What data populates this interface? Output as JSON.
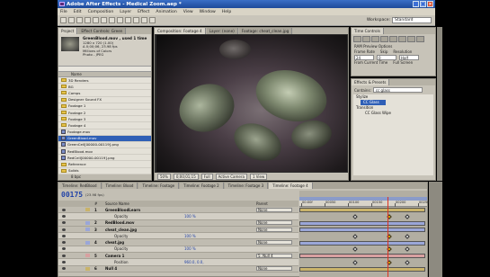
{
  "window": {
    "title": "Adobe After Effects - Medical Zoom.aep *"
  },
  "menu": [
    "File",
    "Edit",
    "Composition",
    "Layer",
    "Effect",
    "Animation",
    "View",
    "Window",
    "Help"
  ],
  "toolbar": {
    "workspace_label": "Workspace:",
    "workspace_value": "Standard"
  },
  "project": {
    "tabs": [
      "Project",
      "Effect Controls: Green"
    ],
    "selected_name": "GreenBlood.mov , used 1 time",
    "meta": [
      "1280 x 720 (1.00)",
      "Δ 0;00;06, 23.98 fps",
      "Millions of Colors",
      "Photo - JPEG"
    ],
    "column_header": "Name",
    "items": [
      {
        "label": "3D Renders",
        "kind": "folder"
      },
      {
        "label": "BG",
        "kind": "folder"
      },
      {
        "label": "Comps",
        "kind": "folder"
      },
      {
        "label": "Designer Sound FX",
        "kind": "folder"
      },
      {
        "label": "Footage 1",
        "kind": "folder"
      },
      {
        "label": "Footage 2",
        "kind": "folder"
      },
      {
        "label": "Footage 3",
        "kind": "folder"
      },
      {
        "label": "Footage 4",
        "kind": "folder"
      },
      {
        "label": "Footage.mov",
        "kind": "file"
      },
      {
        "label": "GreenBlood.mov",
        "kind": "file",
        "selected": true
      },
      {
        "label": "GreenCell[00000-00119].png",
        "kind": "file"
      },
      {
        "label": "RedBlood.mov",
        "kind": "file"
      },
      {
        "label": "RedCell[00000-00119].png",
        "kind": "file"
      },
      {
        "label": "Reference",
        "kind": "folder"
      },
      {
        "label": "Solids",
        "kind": "folder"
      }
    ],
    "footer": "8 bpc"
  },
  "composition": {
    "tabs": [
      "Composition: Footage 4",
      "Layer: (none)",
      "Footage: cheat_clean.jpg"
    ],
    "zoom": "50%",
    "timecode": "0;00;01;15",
    "resolution": "Full",
    "camera": "Active Camera",
    "views": "1 View"
  },
  "time_controls": {
    "tab": "Time Controls",
    "subtab": "RAM Preview Options",
    "labels": [
      "Frame Rate",
      "Skip",
      "Resolution"
    ],
    "values": [
      "24",
      "0",
      "Half"
    ],
    "options": [
      "From Current Time",
      "Full Screen"
    ]
  },
  "effects": {
    "tab": "Effects & Presets",
    "contains_label": "Contains:",
    "search_value": "cc glass",
    "items": [
      {
        "label": "Stylize",
        "indent": 0
      },
      {
        "label": "CC Glass",
        "indent": 1,
        "selected": true
      },
      {
        "label": "Transition",
        "indent": 0
      },
      {
        "label": "CC Glass Wipe",
        "indent": 1
      }
    ]
  },
  "timeline": {
    "tabs": [
      "Timeline: RedBlood",
      "Timeline: Blood",
      "Timeline: Footage",
      "Timeline: Footage 2",
      "Timeline: Footage 3",
      "Timeline: Footage 4"
    ],
    "current_time": "00175",
    "fps": "(23.98 fps)",
    "headers": [
      "#",
      "Source Name",
      "Parent"
    ],
    "ruler_labels": [
      "00:00f",
      "00050",
      "00100",
      "00150",
      "00200",
      "00250"
    ],
    "rows": [
      {
        "num": "1",
        "name": "GreenBloodLearn",
        "parent": "None",
        "kind": "layer"
      },
      {
        "num": "",
        "name": "Opacity",
        "value": "100 %",
        "kind": "prop"
      },
      {
        "num": "2",
        "name": "RedBlood.mov",
        "parent": "None",
        "kind": "layer"
      },
      {
        "num": "3",
        "name": "cheat_clean.jpg",
        "parent": "None",
        "kind": "layer"
      },
      {
        "num": "",
        "name": "Opacity",
        "value": "100 %",
        "kind": "prop"
      },
      {
        "num": "4",
        "name": "cheat.jpg",
        "parent": "None",
        "kind": "layer"
      },
      {
        "num": "",
        "name": "Opacity",
        "value": "100 %",
        "kind": "prop"
      },
      {
        "num": "5",
        "name": "Camera 1",
        "parent": "5. Null 4",
        "kind": "layer"
      },
      {
        "num": "",
        "name": "Position",
        "value": "960.0, 0.0,",
        "kind": "prop"
      },
      {
        "num": "6",
        "name": "Null 4",
        "parent": "None",
        "kind": "layer"
      }
    ]
  }
}
